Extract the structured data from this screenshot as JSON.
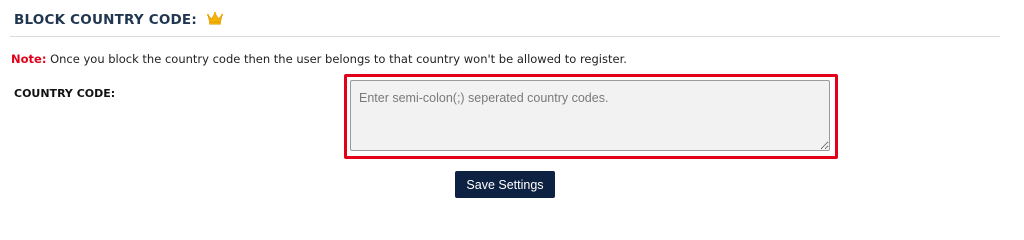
{
  "section": {
    "title": "BLOCK COUNTRY CODE:",
    "premium_icon": "crown-icon",
    "premium_icon_color": "#f5b301"
  },
  "note": {
    "label": "Note:",
    "text": " Once you block the country code then the user belongs to that country won't be allowed to register."
  },
  "form": {
    "country_code_label": "COUNTRY CODE:",
    "country_code_value": "",
    "country_code_placeholder": "Enter semi-colon(;) seperated country codes.",
    "save_label": "Save Settings"
  },
  "colors": {
    "title": "#1f3550",
    "note_label": "#e0001b",
    "highlight_border": "#e2001a",
    "button_background": "#0d2142",
    "button_text": "#ffffff",
    "textarea_background": "#f2f2f2"
  }
}
